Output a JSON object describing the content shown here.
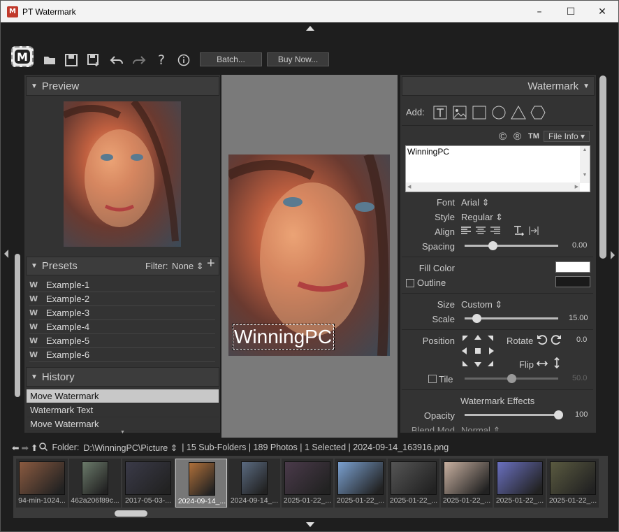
{
  "window": {
    "title": "PT Watermark",
    "app_icon": "M",
    "minimize": "–",
    "maximize": "☐",
    "close": "✕"
  },
  "toolbar": {
    "logo": "M",
    "batch_label": "Batch...",
    "buy_label": "Buy Now...",
    "help": "?",
    "info": "i"
  },
  "left": {
    "preview_title": "Preview",
    "presets_title": "Presets",
    "filter_label": "Filter:",
    "filter_value": "None",
    "add": "+",
    "presets": [
      "Example-1",
      "Example-2",
      "Example-3",
      "Example-4",
      "Example-5",
      "Example-6"
    ],
    "history_title": "History",
    "history": [
      "Move Watermark",
      "Watermark Text",
      "Move Watermark"
    ]
  },
  "canvas": {
    "watermark_text": "WinningPC"
  },
  "right": {
    "title": "Watermark",
    "add_label": "Add:",
    "symbols": {
      "copyright": "©",
      "registered": "®",
      "trademark": "TM"
    },
    "file_info": "File Info",
    "text_value": "WinningPC",
    "font_label": "Font",
    "font_value": "Arial",
    "style_label": "Style",
    "style_value": "Regular",
    "align_label": "Align",
    "spacing_label": "Spacing",
    "spacing_value": "0.00",
    "spacing_level": 0.3,
    "fill_label": "Fill Color",
    "fill_color": "#ffffff",
    "outline_label": "Outline",
    "outline_color": "#1a1a1a",
    "size_label": "Size",
    "size_value": "Custom",
    "scale_label": "Scale",
    "scale_value": "15.00",
    "scale_level": 0.13,
    "position_label": "Position",
    "rotate_label": "Rotate",
    "rotate_value": "0.0",
    "flip_label": "Flip",
    "tile_label": "Tile",
    "tile_value": "50.0",
    "tile_level": 0.5,
    "effects_title": "Watermark Effects",
    "opacity_label": "Opacity",
    "opacity_value": "100",
    "opacity_level": 1.0,
    "blend_label": "Blend Mod",
    "blend_value": "Normal"
  },
  "pathbar": {
    "folder_label": "Folder:",
    "folder_path": "D:\\WinningPC\\Picture",
    "status": "| 15 Sub-Folders | 189 Photos | 1 Selected | 2024-09-14_163916.png"
  },
  "filmstrip": [
    {
      "caption": "94-min-1024...",
      "color": "#8a5a40"
    },
    {
      "caption": "462a206f89c...",
      "color": "#6b7a6a"
    },
    {
      "caption": "2017-05-03-...",
      "color": "#3a3a48"
    },
    {
      "caption": "2024-09-14_...",
      "color": "#b0703a",
      "selected": true
    },
    {
      "caption": "2024-09-14_...",
      "color": "#5a6a80"
    },
    {
      "caption": "2025-01-22_...",
      "color": "#4a3a4a"
    },
    {
      "caption": "2025-01-22_...",
      "color": "#7aa0d0"
    },
    {
      "caption": "2025-01-22_...",
      "color": "#555555"
    },
    {
      "caption": "2025-01-22_...",
      "color": "#c8b0a0"
    },
    {
      "caption": "2025-01-22_...",
      "color": "#6a70c0"
    },
    {
      "caption": "2025-01-22_...",
      "color": "#5a5a40"
    }
  ]
}
